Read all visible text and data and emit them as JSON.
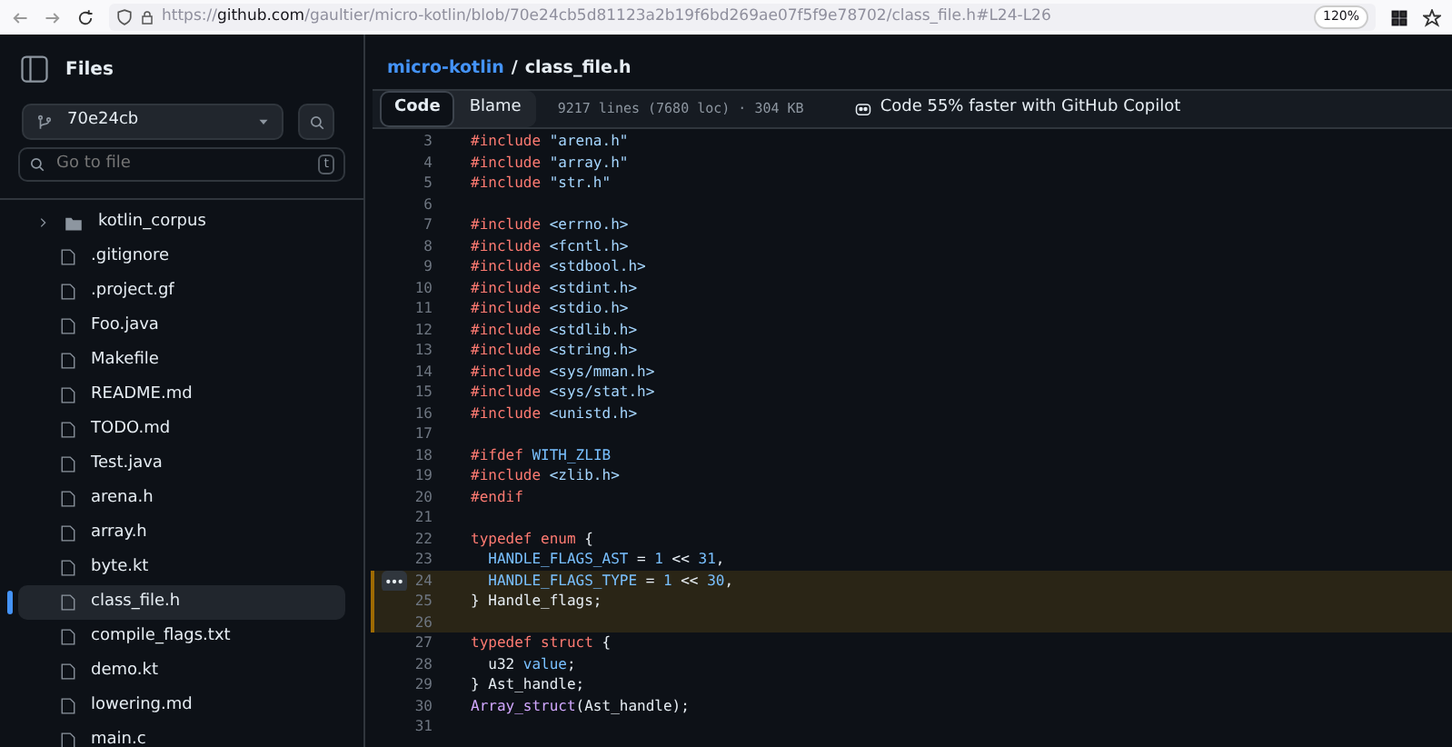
{
  "browser": {
    "url_scheme": "https://",
    "url_domain": "github.com",
    "url_path": "/gaultier/micro-kotlin/blob/70e24cb5d81123a2b19f6bd269ae07f5f9e78702/class_file.h#L24-L26",
    "zoom": "120%"
  },
  "sidebar": {
    "title": "Files",
    "branch": "70e24cb",
    "search": {
      "placeholder": "Go to file",
      "shortcut": "t"
    },
    "tree": [
      {
        "name": "kotlin_corpus",
        "kind": "folder",
        "expanded": false,
        "selected": false
      },
      {
        "name": ".gitignore",
        "kind": "file",
        "selected": false
      },
      {
        "name": ".project.gf",
        "kind": "file",
        "selected": false
      },
      {
        "name": "Foo.java",
        "kind": "file",
        "selected": false
      },
      {
        "name": "Makefile",
        "kind": "file",
        "selected": false
      },
      {
        "name": "README.md",
        "kind": "file",
        "selected": false
      },
      {
        "name": "TODO.md",
        "kind": "file",
        "selected": false
      },
      {
        "name": "Test.java",
        "kind": "file",
        "selected": false
      },
      {
        "name": "arena.h",
        "kind": "file",
        "selected": false
      },
      {
        "name": "array.h",
        "kind": "file",
        "selected": false
      },
      {
        "name": "byte.kt",
        "kind": "file",
        "selected": false
      },
      {
        "name": "class_file.h",
        "kind": "file",
        "selected": true
      },
      {
        "name": "compile_flags.txt",
        "kind": "file",
        "selected": false
      },
      {
        "name": "demo.kt",
        "kind": "file",
        "selected": false
      },
      {
        "name": "lowering.md",
        "kind": "file",
        "selected": false
      },
      {
        "name": "main.c",
        "kind": "file",
        "selected": false
      }
    ]
  },
  "breadcrumb": {
    "repo": "micro-kotlin",
    "separator": "/",
    "file": "class_file.h"
  },
  "tabs": [
    {
      "label": "Code",
      "selected": true
    },
    {
      "label": "Blame",
      "selected": false
    }
  ],
  "file_info": "9217 lines (7680 loc) · 304 KB",
  "copilot_promo": "Code 55% faster with GitHub Copilot",
  "code_lines": [
    {
      "number": "3",
      "selected": false,
      "tokens": [
        {
          "kind": "keyword",
          "text": "#include"
        },
        {
          "kind": "string",
          "text": " \"arena.h\""
        }
      ]
    },
    {
      "number": "4",
      "selected": false,
      "tokens": [
        {
          "kind": "keyword",
          "text": "#include"
        },
        {
          "kind": "string",
          "text": " \"array.h\""
        }
      ]
    },
    {
      "number": "5",
      "selected": false,
      "tokens": [
        {
          "kind": "keyword",
          "text": "#include"
        },
        {
          "kind": "string",
          "text": " \"str.h\""
        }
      ]
    },
    {
      "number": "6",
      "selected": false
    },
    {
      "number": "7",
      "selected": false,
      "tokens": [
        {
          "kind": "keyword",
          "text": "#include"
        },
        {
          "kind": "string",
          "text": " <errno.h>"
        }
      ]
    },
    {
      "number": "8",
      "selected": false,
      "tokens": [
        {
          "kind": "keyword",
          "text": "#include"
        },
        {
          "kind": "string",
          "text": " <fcntl.h>"
        }
      ]
    },
    {
      "number": "9",
      "selected": false,
      "tokens": [
        {
          "kind": "keyword",
          "text": "#include"
        },
        {
          "kind": "string",
          "text": " <stdbool.h>"
        }
      ]
    },
    {
      "number": "10",
      "selected": false,
      "tokens": [
        {
          "kind": "keyword",
          "text": "#include"
        },
        {
          "kind": "string",
          "text": " <stdint.h>"
        }
      ]
    },
    {
      "number": "11",
      "selected": false,
      "tokens": [
        {
          "kind": "keyword",
          "text": "#include"
        },
        {
          "kind": "string",
          "text": " <stdio.h>"
        }
      ]
    },
    {
      "number": "12",
      "selected": false,
      "tokens": [
        {
          "kind": "keyword",
          "text": "#include"
        },
        {
          "kind": "string",
          "text": " <stdlib.h>"
        }
      ]
    },
    {
      "number": "13",
      "selected": false,
      "tokens": [
        {
          "kind": "keyword",
          "text": "#include"
        },
        {
          "kind": "string",
          "text": " <string.h>"
        }
      ]
    },
    {
      "number": "14",
      "selected": false,
      "tokens": [
        {
          "kind": "keyword",
          "text": "#include"
        },
        {
          "kind": "string",
          "text": " <sys/mman.h>"
        }
      ]
    },
    {
      "number": "15",
      "selected": false,
      "tokens": [
        {
          "kind": "keyword",
          "text": "#include"
        },
        {
          "kind": "string",
          "text": " <sys/stat.h>"
        }
      ]
    },
    {
      "number": "16",
      "selected": false,
      "tokens": [
        {
          "kind": "keyword",
          "text": "#include"
        },
        {
          "kind": "string",
          "text": " <unistd.h>"
        }
      ]
    },
    {
      "number": "17",
      "selected": false
    },
    {
      "number": "18",
      "selected": false,
      "tokens": [
        {
          "kind": "keyword",
          "text": "#ifdef"
        },
        {
          "kind": "constant",
          "text": " WITH_ZLIB"
        }
      ]
    },
    {
      "number": "19",
      "selected": false,
      "tokens": [
        {
          "kind": "keyword",
          "text": "#include"
        },
        {
          "kind": "string",
          "text": " <zlib.h>"
        }
      ]
    },
    {
      "number": "20",
      "selected": false,
      "tokens": [
        {
          "kind": "keyword",
          "text": "#endif"
        }
      ]
    },
    {
      "number": "21",
      "selected": false
    },
    {
      "number": "22",
      "selected": false,
      "tokens": [
        {
          "kind": "keyword",
          "text": "typedef enum"
        },
        {
          "kind": "plain",
          "text": " {"
        }
      ]
    },
    {
      "number": "23",
      "selected": false,
      "tokens": [
        {
          "kind": "constant",
          "text": "  HANDLE_FLAGS_AST"
        },
        {
          "kind": "plain",
          "text": " = "
        },
        {
          "kind": "constant",
          "text": "1"
        },
        {
          "kind": "plain",
          "text": " << "
        },
        {
          "kind": "constant",
          "text": "31"
        },
        {
          "kind": "plain",
          "text": ","
        }
      ]
    },
    {
      "number": "24",
      "selected": true,
      "menu": true,
      "tokens": [
        {
          "kind": "constant",
          "text": "  HANDLE_FLAGS_TYPE"
        },
        {
          "kind": "plain",
          "text": " = "
        },
        {
          "kind": "constant",
          "text": "1"
        },
        {
          "kind": "plain",
          "text": " << "
        },
        {
          "kind": "constant",
          "text": "30"
        },
        {
          "kind": "plain",
          "text": ","
        }
      ]
    },
    {
      "number": "25",
      "selected": true,
      "tokens": [
        {
          "kind": "plain",
          "text": "} Handle_flags;"
        }
      ]
    },
    {
      "number": "26",
      "selected": true
    },
    {
      "number": "27",
      "selected": false,
      "tokens": [
        {
          "kind": "keyword",
          "text": "typedef struct"
        },
        {
          "kind": "plain",
          "text": " {"
        }
      ]
    },
    {
      "number": "28",
      "selected": false,
      "tokens": [
        {
          "kind": "plain",
          "text": "  u32 "
        },
        {
          "kind": "constant",
          "text": "value"
        },
        {
          "kind": "plain",
          "text": ";"
        }
      ]
    },
    {
      "number": "29",
      "selected": false,
      "tokens": [
        {
          "kind": "plain",
          "text": "} Ast_handle;"
        }
      ]
    },
    {
      "number": "30",
      "selected": false,
      "tokens": [
        {
          "kind": "function",
          "text": "Array_struct"
        },
        {
          "kind": "plain",
          "text": "(Ast_handle);"
        }
      ]
    },
    {
      "number": "31",
      "selected": false
    }
  ]
}
